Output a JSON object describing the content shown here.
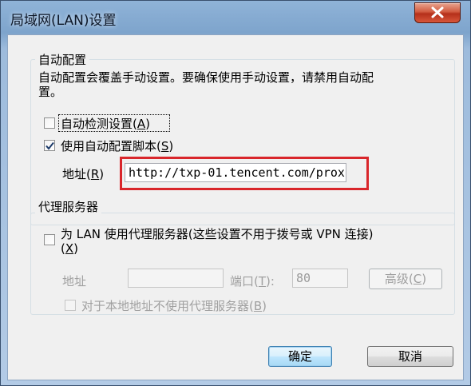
{
  "window": {
    "title": "局域网(LAN)设置"
  },
  "auto_config": {
    "legend": "自动配置",
    "description_line1": "自动配置会覆盖手动设置。要确保使用手动设置，请禁用自动配",
    "description_line2": "置。",
    "auto_detect": {
      "label": "自动检测设置(",
      "accel": "A",
      "label_end": ")",
      "checked": false
    },
    "use_script": {
      "label": "使用自动配置脚本(",
      "accel": "S",
      "label_end": ")",
      "checked": true
    },
    "address_label": "地址(",
    "address_accel": "R",
    "address_label_end": ")",
    "address_value": "http://txp-01.tencent.com/prox"
  },
  "proxy": {
    "legend": "代理服务器",
    "use_proxy_line1": "为 LAN 使用代理服务器(这些设置不用于拨号或 VPN 连接)",
    "use_proxy_line2_open": "(",
    "use_proxy_accel": "X",
    "use_proxy_line2_close": ")",
    "use_proxy_checked": false,
    "address_label": "地址",
    "address_value": "",
    "port_label": "端口(",
    "port_accel": "T",
    "port_label_end": "):",
    "port_value": "80",
    "advanced_label": "高级(",
    "advanced_accel": "C",
    "advanced_label_end": ")",
    "bypass_label": "对于本地地址不使用代理服务器(",
    "bypass_accel": "B",
    "bypass_label_end": ")",
    "bypass_checked": false
  },
  "buttons": {
    "ok": "确定",
    "cancel": "取消"
  },
  "colors": {
    "highlight": "#d9262b",
    "title_bar": "#8fb3d8"
  }
}
